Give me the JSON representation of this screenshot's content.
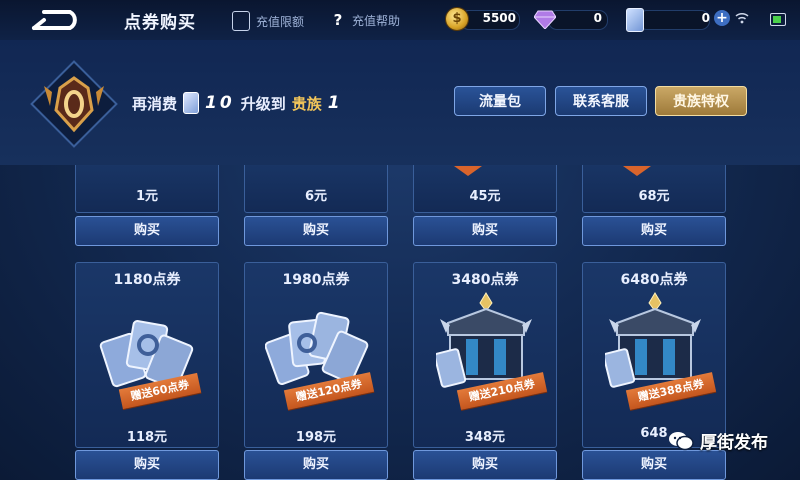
{
  "header": {
    "title": "点券购买",
    "links": [
      {
        "label": "充值限额"
      },
      {
        "label": "充值帮助"
      }
    ],
    "currencies": {
      "coins": "5500",
      "coin_symbol": "$",
      "gems": "0",
      "tickets": "0"
    }
  },
  "vip": {
    "text_prefix": "再消费",
    "amount": "10",
    "text_mid": "升级到",
    "rank": "贵族",
    "level": "1",
    "buttons": [
      "流量包",
      "联系客服",
      "贵族特权"
    ]
  },
  "top_row": [
    {
      "price": "1元",
      "buy": "购买"
    },
    {
      "price": "6元",
      "buy": "购买"
    },
    {
      "price": "45元",
      "buy": "购买"
    },
    {
      "price": "68元",
      "buy": "购买"
    }
  ],
  "bottom_row": [
    {
      "amount": "1180点券",
      "bonus": "赠送60点券",
      "price": "118元",
      "buy": "购买",
      "art": "cards"
    },
    {
      "amount": "1980点券",
      "bonus": "赠送120点券",
      "price": "198元",
      "buy": "购买",
      "art": "cards"
    },
    {
      "amount": "3480点券",
      "bonus": "赠送210点券",
      "price": "348元",
      "buy": "购买",
      "art": "chest"
    },
    {
      "amount": "6480点券",
      "bonus": "赠送388点券",
      "price": "648",
      "buy": "购买",
      "art": "chest"
    }
  ],
  "watermark": "厚街发布",
  "colors": {
    "accent_gold": "#f0c45a",
    "ribbon_orange": "#d9642b",
    "button_blue": "#2a5195"
  }
}
